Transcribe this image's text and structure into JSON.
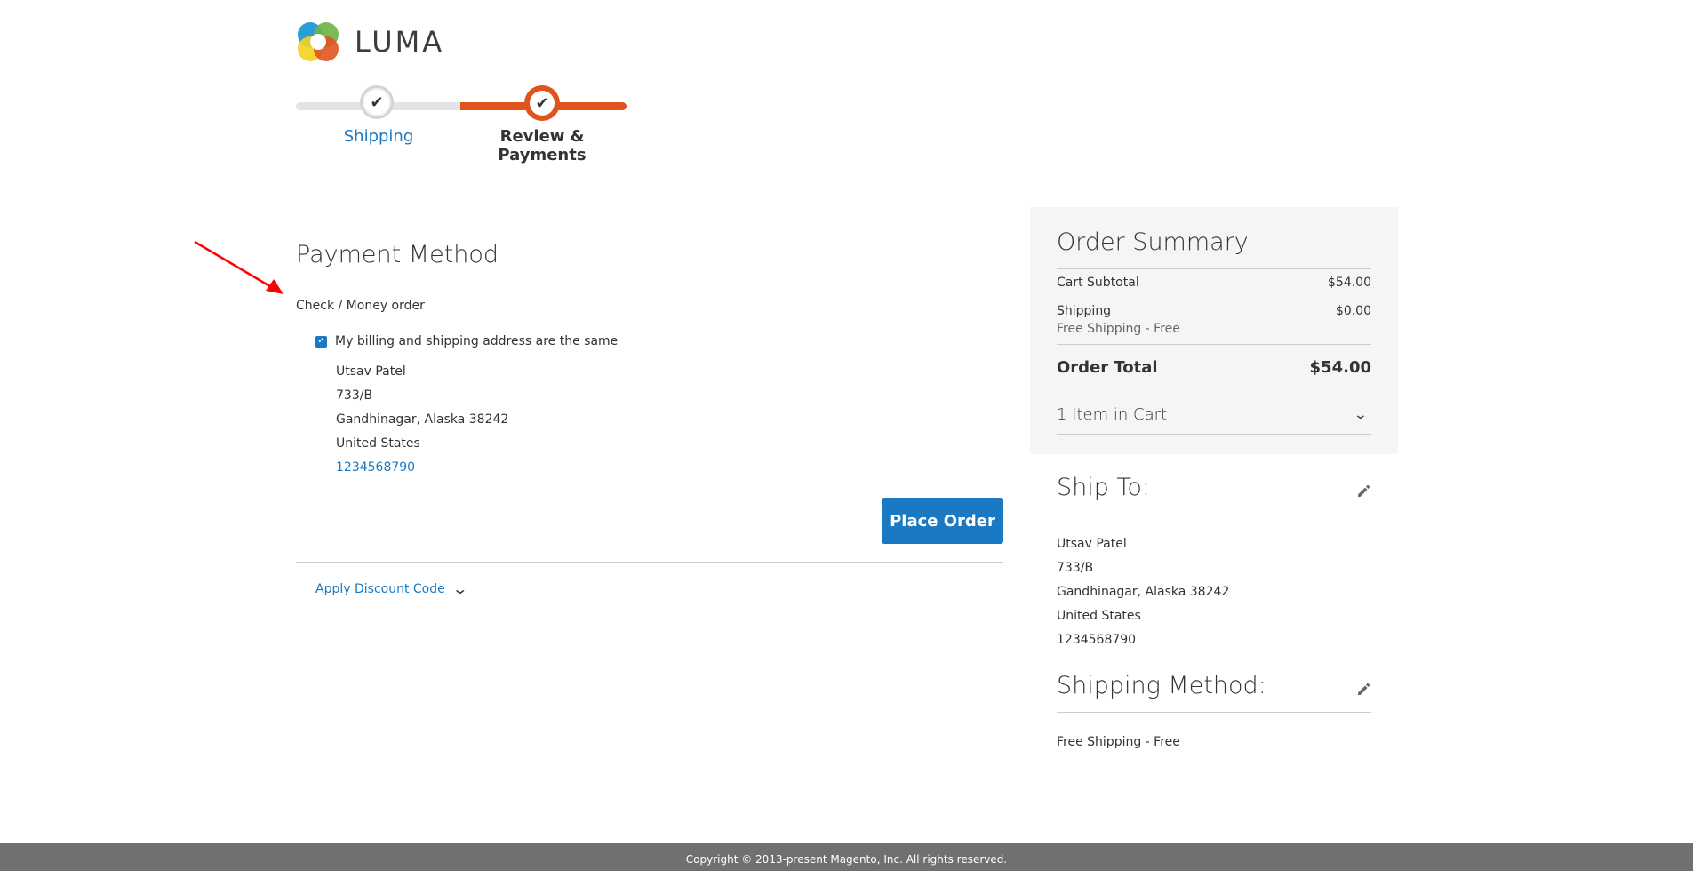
{
  "header": {
    "logo_text": "LUMA",
    "logo_colors": {
      "blue": "#1d9ad6",
      "green": "#6bb446",
      "yellow": "#f4d11f",
      "orange": "#e0531e"
    }
  },
  "progress": {
    "steps": [
      {
        "label": "Shipping",
        "state": "complete"
      },
      {
        "label": "Review & Payments",
        "state": "active"
      }
    ],
    "accent_color": "#e0531e"
  },
  "payment": {
    "title": "Payment Method",
    "method_label": "Check / Money order",
    "billing_same_label": "My billing and shipping address are the same",
    "billing_same_checked": true,
    "address": {
      "name": "Utsav Patel",
      "street": "733/B",
      "city_region": "Gandhinagar, Alaska 38242",
      "country": "United States",
      "phone": "1234568790"
    },
    "place_order_label": "Place Order",
    "discount_label": "Apply Discount Code"
  },
  "summary": {
    "title": "Order Summary",
    "cart_subtotal_label": "Cart Subtotal",
    "cart_subtotal_value": "$54.00",
    "shipping_label": "Shipping",
    "shipping_value": "$0.00",
    "shipping_method": "Free Shipping - Free",
    "order_total_label": "Order Total",
    "order_total_value": "$54.00",
    "items_in_cart_label": "1 Item in Cart"
  },
  "ship_to": {
    "title": "Ship To:",
    "name": "Utsav Patel",
    "street": "733/B",
    "city_region": "Gandhinagar, Alaska 38242",
    "country": "United States",
    "phone": "1234568790"
  },
  "shipping_method": {
    "title": "Shipping Method:",
    "value": "Free Shipping - Free"
  },
  "footer": {
    "copyright": "Copyright © 2013-present Magento, Inc. All rights reserved."
  },
  "brand_colors": {
    "primary_blue": "#1979c3",
    "footer_gray": "#6e716e",
    "annotation_red": "#ff0000"
  }
}
